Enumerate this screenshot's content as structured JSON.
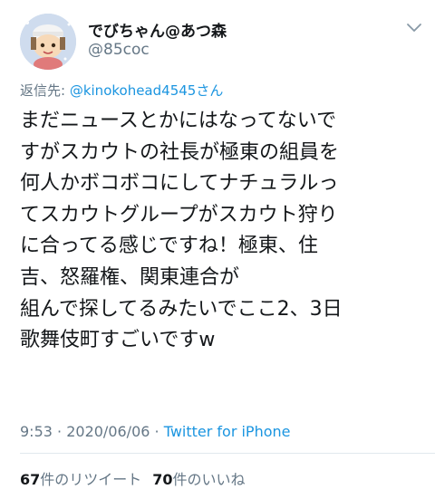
{
  "author": {
    "display_name": "でびちゃん@あつ森",
    "handle": "@85coc"
  },
  "reply": {
    "prefix": "返信先: ",
    "mention": "@kinokohead4545さん"
  },
  "tweet": {
    "lines": [
      "まだニュースとかにはなってないで",
      "すがスカウトの社長が極東の組員を",
      "何人かボコボコにしてナチュラルっ",
      "てスカウトグループがスカウト狩り",
      "に合ってる感じですね！極東、住",
      "吉、怒羅権、関東連合が",
      "組んで探してるみたいでここ2、3日",
      "歌舞伎町すごいですw"
    ]
  },
  "meta": {
    "time": "9:53",
    "separator1": " · ",
    "date": "2020/06/06",
    "separator2": " · ",
    "source": "Twitter for iPhone"
  },
  "stats": {
    "retweet_count": "67",
    "retweet_label": "件のリツイート",
    "like_count": "70",
    "like_label": "件のいいね"
  },
  "colors": {
    "link": "#1b95e0",
    "secondary_text": "#657786",
    "primary_text": "#14171a",
    "divider": "#e1e8ed"
  },
  "icons": {
    "menu": "chevron-down-icon",
    "avatar": "avatar"
  }
}
